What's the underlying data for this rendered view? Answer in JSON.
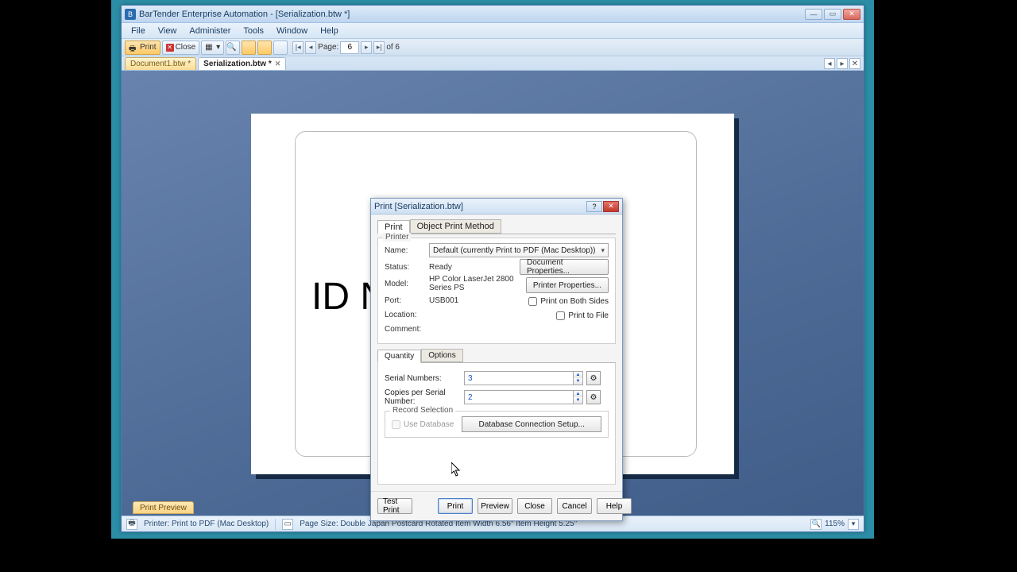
{
  "titlebar": {
    "title": "BarTender Enterprise Automation - [Serialization.btw *]"
  },
  "menus": [
    "File",
    "View",
    "Administer",
    "Tools",
    "Window",
    "Help"
  ],
  "toolbar": {
    "print": "Print",
    "close": "Close",
    "page_label": "Page:",
    "page_value": "6",
    "page_total": "of 6"
  },
  "doctabs": {
    "inactive": "Document1.btw *",
    "active": "Serialization.btw *"
  },
  "canvas_text": "ID N",
  "bottom_tab": "Print Preview",
  "statusbar": {
    "printer": "Printer: Print to PDF (Mac Desktop)",
    "pagesize": "Page Size: Double Japan Postcard Rotated  Item Width 6.56\"  Item Height 5.25\"",
    "zoom": "115%"
  },
  "dialog": {
    "title": "Print [Serialization.btw]",
    "tabs": {
      "print": "Print",
      "opm": "Object Print Method"
    },
    "printer_legend": "Printer",
    "name_label": "Name:",
    "name_value": "Default (currently Print to PDF (Mac Desktop))",
    "status_label": "Status:",
    "status_value": "Ready",
    "model_label": "Model:",
    "model_value": "HP Color LaserJet 2800 Series PS",
    "port_label": "Port:",
    "port_value": "USB001",
    "location_label": "Location:",
    "location_value": "",
    "comment_label": "Comment:",
    "comment_value": "",
    "docprops": "Document Properties...",
    "prnprops": "Printer Properties...",
    "both_sides": "Print on Both Sides",
    "to_file": "Print to File",
    "qtabs": {
      "quantity": "Quantity",
      "options": "Options"
    },
    "serial_label": "Serial Numbers:",
    "serial_value": "3",
    "copies_label": "Copies per Serial Number:",
    "copies_value": "2",
    "recsel_legend": "Record Selection",
    "use_db": "Use Database",
    "dbsetup": "Database Connection Setup...",
    "buttons": {
      "test": "Test Print",
      "print": "Print",
      "preview": "Preview",
      "close": "Close",
      "cancel": "Cancel",
      "help": "Help"
    }
  }
}
